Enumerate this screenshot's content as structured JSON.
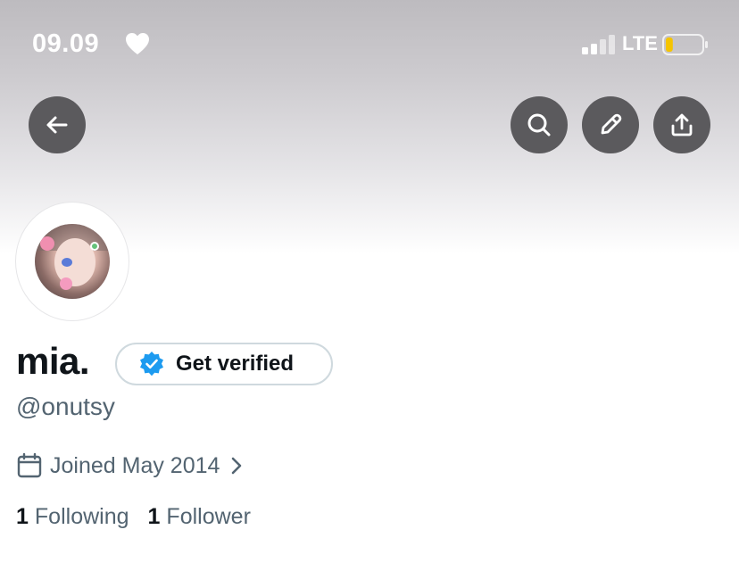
{
  "status_bar": {
    "time": "09.09",
    "heart_icon": "heart-icon",
    "network": "LTE",
    "signal_icon": "cellular-signal-icon",
    "battery_icon": "battery-low-icon",
    "battery_level_fraction": 0.2,
    "battery_color": "#f5c400"
  },
  "header": {
    "back_icon": "arrow-left-icon",
    "search_icon": "search-icon",
    "edit_icon": "pencil-icon",
    "share_icon": "share-icon"
  },
  "profile": {
    "avatar_icon": "profile-photo",
    "display_name": "mia.",
    "verify_button_label": "Get verified",
    "verify_icon": "verified-badge-icon",
    "verify_color": "#1d9bf0",
    "handle": "@onutsy",
    "joined_text": "Joined May 2014",
    "calendar_icon": "calendar-icon",
    "chevron_icon": "chevron-right-icon",
    "following_count": "1",
    "following_label": "Following",
    "followers_count": "1",
    "followers_label": "Follower"
  },
  "colors": {
    "text_primary": "#0f1419",
    "text_secondary": "#536471",
    "button_bg": "#5b5a5d"
  }
}
